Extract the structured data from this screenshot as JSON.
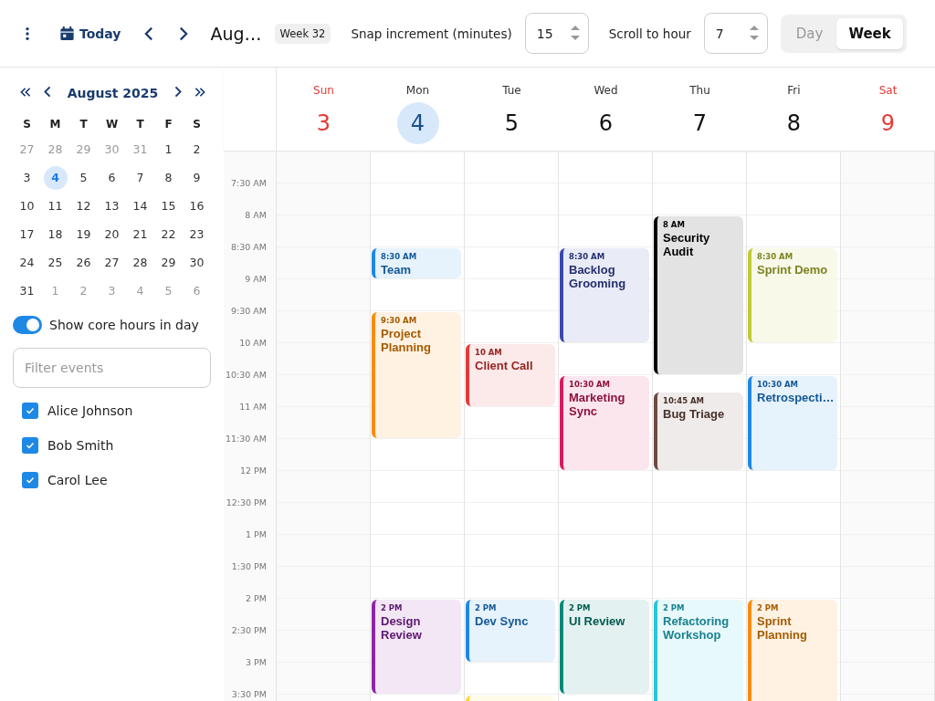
{
  "toolbar": {
    "today_label": "Today",
    "title": "Aug…",
    "week_badge": "Week 32",
    "snap_label": "Snap increment (minutes)",
    "snap_value": "15",
    "scroll_label": "Scroll to hour",
    "scroll_value": "7",
    "views": [
      {
        "label": "Day",
        "selected": false
      },
      {
        "label": "Week",
        "selected": true
      }
    ]
  },
  "sidebar": {
    "mini_calendar": {
      "title": "August 2025",
      "weekdays": [
        "S",
        "M",
        "T",
        "W",
        "T",
        "F",
        "S"
      ],
      "weeks": [
        [
          {
            "d": "27",
            "outside": true,
            "selected": false
          },
          {
            "d": "28",
            "outside": true,
            "selected": false
          },
          {
            "d": "29",
            "outside": true,
            "selected": false
          },
          {
            "d": "30",
            "outside": true,
            "selected": false
          },
          {
            "d": "31",
            "outside": true,
            "selected": false
          },
          {
            "d": "1",
            "outside": false,
            "selected": false
          },
          {
            "d": "2",
            "outside": false,
            "selected": false
          }
        ],
        [
          {
            "d": "3",
            "outside": false,
            "selected": false
          },
          {
            "d": "4",
            "outside": false,
            "selected": true
          },
          {
            "d": "5",
            "outside": false,
            "selected": false
          },
          {
            "d": "6",
            "outside": false,
            "selected": false
          },
          {
            "d": "7",
            "outside": false,
            "selected": false
          },
          {
            "d": "8",
            "outside": false,
            "selected": false
          },
          {
            "d": "9",
            "outside": false,
            "selected": false
          }
        ],
        [
          {
            "d": "10",
            "outside": false,
            "selected": false
          },
          {
            "d": "11",
            "outside": false,
            "selected": false
          },
          {
            "d": "12",
            "outside": false,
            "selected": false
          },
          {
            "d": "13",
            "outside": false,
            "selected": false
          },
          {
            "d": "14",
            "outside": false,
            "selected": false
          },
          {
            "d": "15",
            "outside": false,
            "selected": false
          },
          {
            "d": "16",
            "outside": false,
            "selected": false
          }
        ],
        [
          {
            "d": "17",
            "outside": false,
            "selected": false
          },
          {
            "d": "18",
            "outside": false,
            "selected": false
          },
          {
            "d": "19",
            "outside": false,
            "selected": false
          },
          {
            "d": "20",
            "outside": false,
            "selected": false
          },
          {
            "d": "21",
            "outside": false,
            "selected": false
          },
          {
            "d": "22",
            "outside": false,
            "selected": false
          },
          {
            "d": "23",
            "outside": false,
            "selected": false
          }
        ],
        [
          {
            "d": "24",
            "outside": false,
            "selected": false
          },
          {
            "d": "25",
            "outside": false,
            "selected": false
          },
          {
            "d": "26",
            "outside": false,
            "selected": false
          },
          {
            "d": "27",
            "outside": false,
            "selected": false
          },
          {
            "d": "28",
            "outside": false,
            "selected": false
          },
          {
            "d": "29",
            "outside": false,
            "selected": false
          },
          {
            "d": "30",
            "outside": false,
            "selected": false
          }
        ],
        [
          {
            "d": "31",
            "outside": false,
            "selected": false
          },
          {
            "d": "1",
            "outside": true,
            "selected": false
          },
          {
            "d": "2",
            "outside": true,
            "selected": false
          },
          {
            "d": "3",
            "outside": true,
            "selected": false
          },
          {
            "d": "4",
            "outside": true,
            "selected": false
          },
          {
            "d": "5",
            "outside": true,
            "selected": false
          },
          {
            "d": "6",
            "outside": true,
            "selected": false
          }
        ]
      ]
    },
    "core_hours": {
      "label": "Show core hours in day",
      "on": true
    },
    "filter": {
      "placeholder": "Filter events"
    },
    "people": [
      {
        "name": "Alice Johnson",
        "checked": true
      },
      {
        "name": "Bob Smith",
        "checked": true
      },
      {
        "name": "Carol Lee",
        "checked": true
      }
    ]
  },
  "week": {
    "hours": [
      "7:30 AM",
      "8 AM",
      "8:30 AM",
      "9 AM",
      "9:30 AM",
      "10 AM",
      "10:30 AM",
      "11 AM",
      "11:30 AM",
      "12 PM",
      "12:30 PM",
      "1 PM",
      "1:30 PM",
      "2 PM",
      "2:30 PM",
      "3 PM",
      "3:30 PM"
    ],
    "days": [
      {
        "weekday": "Sun",
        "date": "3",
        "weekend": true,
        "selected": false
      },
      {
        "weekday": "Mon",
        "date": "4",
        "weekend": false,
        "selected": true,
        "events": [
          {
            "time": "8:30 AM",
            "title": "Team",
            "color": "#1e88e5"
          },
          {
            "time": "9:30 AM",
            "title": "Project Planning",
            "color": "#fb8c00"
          },
          {
            "time": "2 PM",
            "title": "Design Review",
            "color": "#8e24aa"
          }
        ]
      },
      {
        "weekday": "Tue",
        "date": "5",
        "weekend": false,
        "selected": false,
        "events": [
          {
            "time": "10 AM",
            "title": "Client Call",
            "color": "#e53935"
          },
          {
            "time": "2 PM",
            "title": "Dev Sync",
            "color": "#1e88e5"
          },
          {
            "color": "#fdd835"
          }
        ]
      },
      {
        "weekday": "Wed",
        "date": "6",
        "weekend": false,
        "selected": false,
        "events": [
          {
            "time": "8:30 AM",
            "title": "Backlog Grooming",
            "color": "#3949ab"
          },
          {
            "time": "10:30 AM",
            "title": "Marketing Sync",
            "color": "#d81b60"
          },
          {
            "time": "2 PM",
            "title": "UI Review",
            "color": "#00897b"
          }
        ]
      },
      {
        "weekday": "Thu",
        "date": "7",
        "weekend": false,
        "selected": false,
        "events": [
          {
            "time": "8 AM",
            "title": "Security Audit",
            "color": "#000000"
          },
          {
            "time": "10:45 AM",
            "title": "Bug Triage",
            "color": "#6d4c41"
          },
          {
            "time": "2 PM",
            "title": "Refactoring Workshop",
            "color": "#26c6da"
          }
        ]
      },
      {
        "weekday": "Fri",
        "date": "8",
        "weekend": false,
        "selected": false,
        "events": [
          {
            "time": "8:30 AM",
            "title": "Sprint Demo",
            "color": "#c0ca33"
          },
          {
            "time": "10:30 AM",
            "title": "Retrospecti…",
            "color": "#1e88e5"
          },
          {
            "time": "2 PM",
            "title": "Sprint Planning",
            "color": "#fb8c00"
          }
        ]
      },
      {
        "weekday": "Sat",
        "date": "9",
        "weekend": true,
        "selected": false
      }
    ]
  }
}
